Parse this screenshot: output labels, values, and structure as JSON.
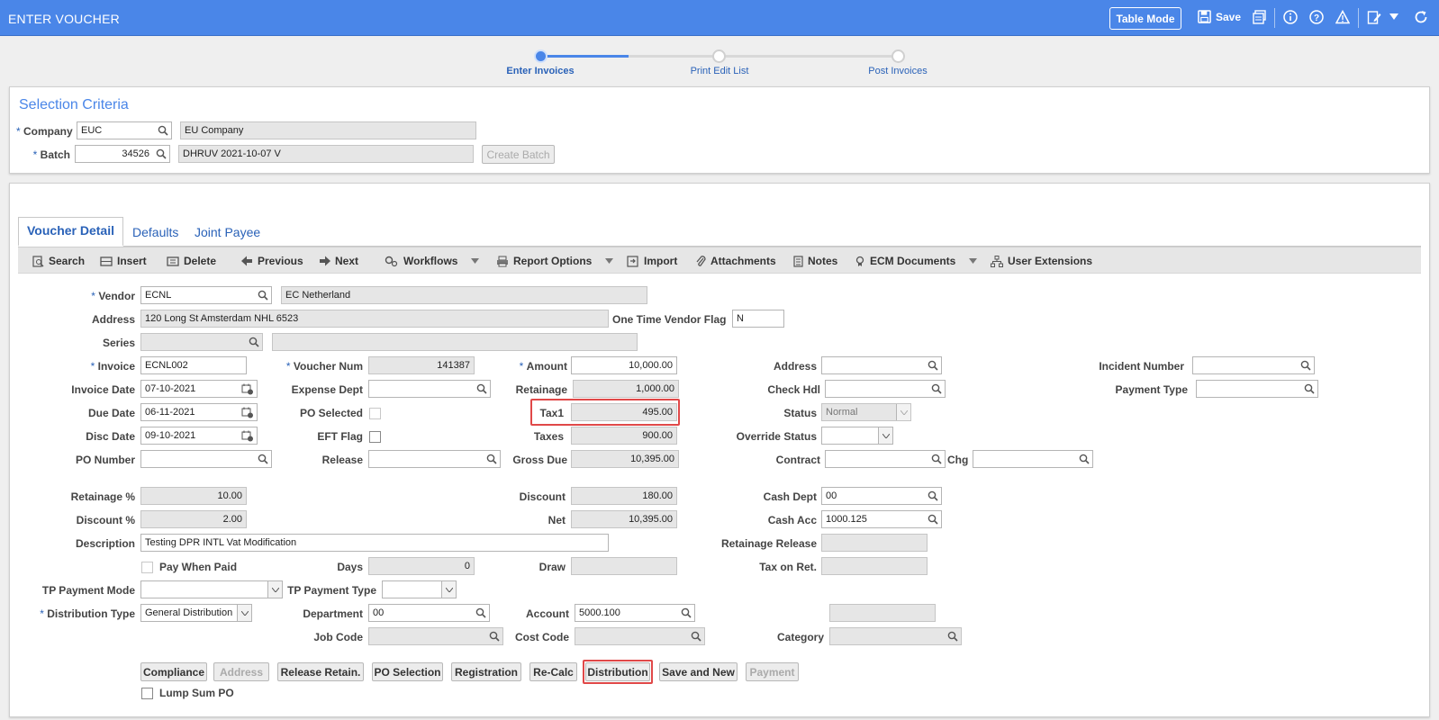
{
  "app": {
    "title": "ENTER VOUCHER",
    "table_mode": "Table Mode",
    "save": "Save"
  },
  "steps": [
    {
      "label": "Enter Invoices",
      "state": "active"
    },
    {
      "label": "Print Edit List",
      "state": "pending"
    },
    {
      "label": "Post Invoices",
      "state": "pending"
    }
  ],
  "selection": {
    "title": "Selection Criteria",
    "company_label": "Company",
    "company_value": "EUC",
    "company_name": "EU Company",
    "batch_label": "Batch",
    "batch_value": "34526",
    "batch_name": "DHRUV 2021-10-07 V",
    "create_batch": "Create Batch"
  },
  "tabs": [
    "Voucher Detail",
    "Defaults",
    "Joint Payee"
  ],
  "toolbar": {
    "search": "Search",
    "insert": "Insert",
    "delete": "Delete",
    "previous": "Previous",
    "next": "Next",
    "workflows": "Workflows",
    "report_options": "Report Options",
    "import": "Import",
    "attachments": "Attachments",
    "notes": "Notes",
    "ecm_documents": "ECM Documents",
    "user_extensions": "User Extensions"
  },
  "labels": {
    "vendor": "Vendor",
    "address": "Address",
    "one_time_vendor_flag": "One Time Vendor Flag",
    "series": "Series",
    "invoice": "Invoice",
    "voucher_num": "Voucher Num",
    "amount": "Amount",
    "address2": "Address",
    "incident_number": "Incident Number",
    "invoice_date": "Invoice Date",
    "expense_dept": "Expense Dept",
    "retainage": "Retainage",
    "check_hdl": "Check Hdl",
    "payment_type": "Payment Type",
    "due_date": "Due Date",
    "po_selected": "PO Selected",
    "tax1": "Tax1",
    "status": "Status",
    "disc_date": "Disc Date",
    "eft_flag": "EFT Flag",
    "taxes": "Taxes",
    "override_status": "Override Status",
    "po_number": "PO Number",
    "release": "Release",
    "gross_due": "Gross Due",
    "contract": "Contract",
    "chg": "Chg",
    "retainage_pct": "Retainage %",
    "discount": "Discount",
    "cash_dept": "Cash Dept",
    "discount_pct": "Discount %",
    "net": "Net",
    "cash_acc": "Cash Acc",
    "description": "Description",
    "retainage_release": "Retainage Release",
    "pay_when_paid": "Pay When Paid",
    "days": "Days",
    "draw": "Draw",
    "tax_on_ret": "Tax on Ret.",
    "tp_payment_mode": "TP Payment Mode",
    "tp_payment_type": "TP Payment Type",
    "distribution_type": "Distribution Type",
    "department": "Department",
    "account": "Account",
    "job_code": "Job Code",
    "cost_code": "Cost Code",
    "category": "Category",
    "lump_sum_po": "Lump Sum PO"
  },
  "values": {
    "vendor": "ECNL",
    "vendor_name": "EC Netherland",
    "address": "120 Long St  Amsterdam NHL 6523",
    "one_time_vendor_flag": "N",
    "invoice": "ECNL002",
    "voucher_num": "141387",
    "amount": "10,000.00",
    "invoice_date": "07-10-2021",
    "retainage": "1,000.00",
    "due_date": "06-11-2021",
    "tax1": "495.00",
    "status": "Normal",
    "disc_date": "09-10-2021",
    "taxes": "900.00",
    "gross_due": "10,395.00",
    "retainage_pct": "10.00",
    "discount": "180.00",
    "cash_dept": "00",
    "discount_pct": "2.00",
    "net": "10,395.00",
    "cash_acc": "1000.125",
    "description": "Testing DPR INTL Vat Modification",
    "days": "0",
    "distribution_type": "General Distribution",
    "department": "00",
    "account": "5000.100"
  },
  "buttons": [
    "Compliance",
    "Address",
    "Release Retain.",
    "PO Selection",
    "Registration",
    "Re-Calc",
    "Distribution",
    "Save and New",
    "Payment"
  ],
  "colors": {
    "accent": "#4a86e8",
    "highlight": "#e04848"
  }
}
